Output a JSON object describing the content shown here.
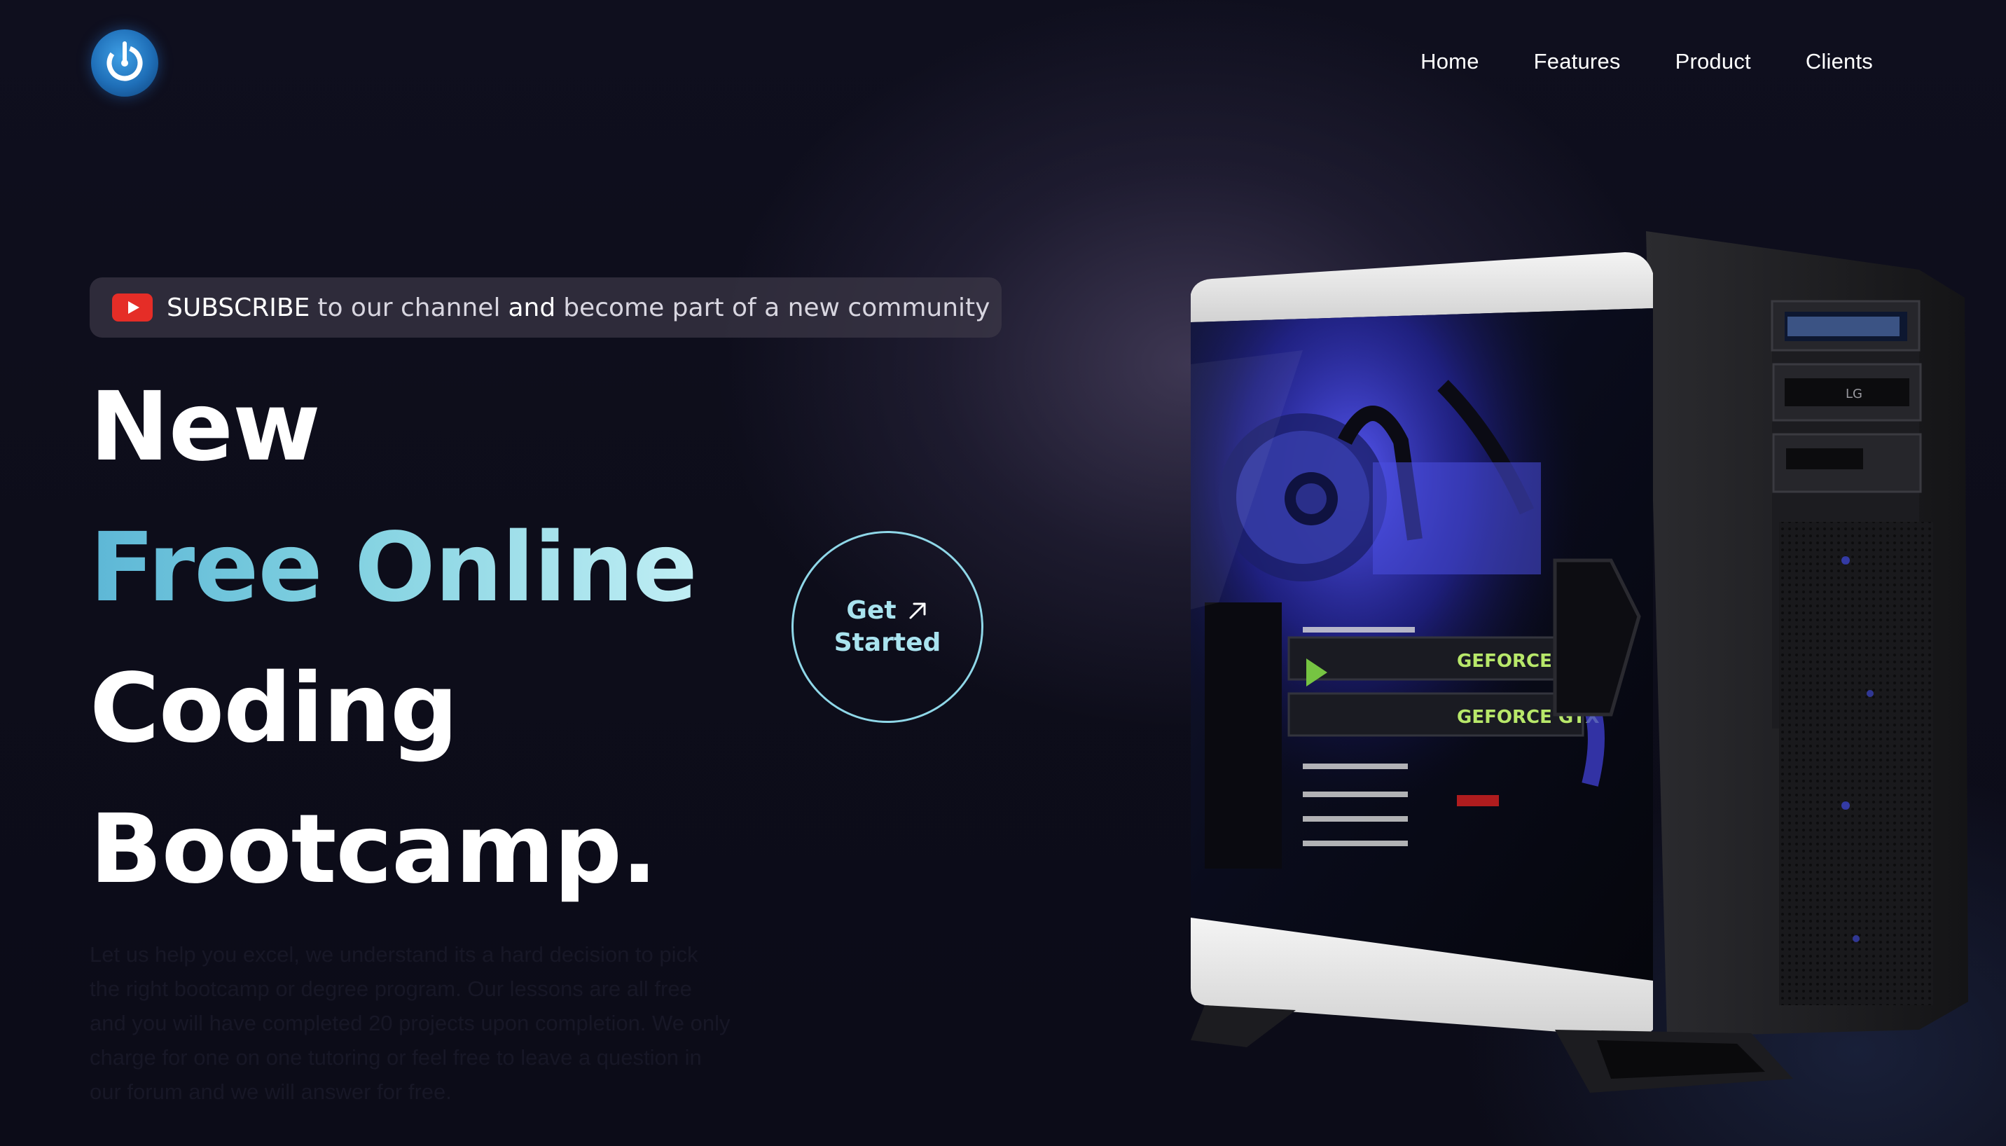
{
  "header": {
    "logo_name": "power-logo",
    "nav": [
      {
        "label": "Home"
      },
      {
        "label": "Features"
      },
      {
        "label": "Product"
      },
      {
        "label": "Clients"
      }
    ]
  },
  "subscribe": {
    "icon": "youtube-icon",
    "word1": "SUBSCRIBE",
    "text1": "to our channel",
    "word2": "and",
    "text2": "become part of a new community"
  },
  "hero": {
    "line1": "New",
    "line2": "Free Online",
    "line3": "Coding",
    "line4": "Bootcamp.",
    "description": "Let us help you excel, we understand its a hard decision to pick the right bootcamp or degree program. Our lessons are all free and you will have completed 20 projects upon completion. We only charge for one on one tutoring or feel free to leave a question in our forum and we will answer for free."
  },
  "cta": {
    "line1": "Get",
    "line2": "Started"
  },
  "product_image": {
    "gpu_label_1": "GEFORCE GTX",
    "gpu_label_2": "GEFORCE GTX",
    "drive_brand": "LG"
  },
  "colors": {
    "accent": "#7fd0e0",
    "cta_border": "#8fd7e8",
    "youtube_red": "#e52d27",
    "background": "#0d0d1a"
  }
}
